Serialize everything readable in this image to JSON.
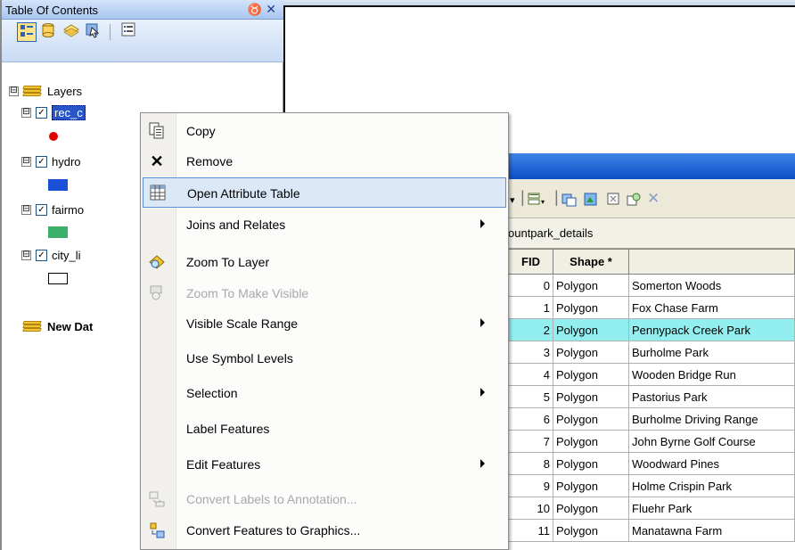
{
  "toc": {
    "title": "Table Of Contents",
    "pin_glyph": "♉",
    "close_glyph": "✕",
    "toolbar": [
      "list-by-drawing-order-icon",
      "list-by-source-icon",
      "list-by-visibility-icon",
      "list-by-selection-icon",
      "options-icon"
    ],
    "root": {
      "label": "Layers",
      "expander": "⊟"
    },
    "layers": [
      {
        "name": "rec_c",
        "checked": "✓",
        "symbol_color": "#e00000"
      },
      {
        "name": "hydro",
        "checked": "✓",
        "symbol_color": "#1a4fd8"
      },
      {
        "name": "fairmo",
        "checked": "✓",
        "symbol_color": "#3ab06a"
      },
      {
        "name": "city_li",
        "checked": "✓",
        "symbol_color": "#ffffff"
      }
    ],
    "second_frame": {
      "label": "New Dat"
    }
  },
  "context_menu": {
    "items": [
      {
        "label": "Copy",
        "icon": "copy-icon",
        "enabled": true,
        "submenu": false
      },
      {
        "label": "Remove",
        "icon": "remove-icon",
        "enabled": true,
        "submenu": false
      },
      {
        "label": "Open Attribute Table",
        "icon": "table-icon",
        "enabled": true,
        "submenu": false,
        "highlighted": true
      },
      {
        "label": "Joins and Relates",
        "icon": "",
        "enabled": true,
        "submenu": true
      },
      {
        "label": "Zoom To Layer",
        "icon": "zoom-to-layer-icon",
        "enabled": true,
        "submenu": false
      },
      {
        "label": "Zoom To Make Visible",
        "icon": "zoom-visible-icon",
        "enabled": false,
        "submenu": false
      },
      {
        "label": "Visible Scale Range",
        "icon": "",
        "enabled": true,
        "submenu": true
      },
      {
        "label": "Use Symbol Levels",
        "icon": "",
        "enabled": true,
        "submenu": false
      },
      {
        "label": "Selection",
        "icon": "",
        "enabled": true,
        "submenu": true
      },
      {
        "label": "Label Features",
        "icon": "",
        "enabled": true,
        "submenu": false
      },
      {
        "label": "Edit Features",
        "icon": "",
        "enabled": true,
        "submenu": true
      },
      {
        "label": "Convert Labels to Annotation...",
        "icon": "convert-labels-icon",
        "enabled": false,
        "submenu": false
      },
      {
        "label": "Convert Features to Graphics...",
        "icon": "convert-features-icon",
        "enabled": true,
        "submenu": false
      }
    ]
  },
  "attribute_table": {
    "tab_label": "ountpark_details",
    "columns": [
      "FID",
      "Shape *",
      ""
    ],
    "rows": [
      {
        "fid": "0",
        "shape": "Polygon",
        "name": "Somerton Woods"
      },
      {
        "fid": "1",
        "shape": "Polygon",
        "name": "Fox Chase Farm"
      },
      {
        "fid": "2",
        "shape": "Polygon",
        "name": "Pennypack Creek Park",
        "selected": true
      },
      {
        "fid": "3",
        "shape": "Polygon",
        "name": "Burholme Park"
      },
      {
        "fid": "4",
        "shape": "Polygon",
        "name": "Wooden Bridge Run"
      },
      {
        "fid": "5",
        "shape": "Polygon",
        "name": "Pastorius Park"
      },
      {
        "fid": "6",
        "shape": "Polygon",
        "name": "Burholme Driving Range"
      },
      {
        "fid": "7",
        "shape": "Polygon",
        "name": "John Byrne Golf Course"
      },
      {
        "fid": "8",
        "shape": "Polygon",
        "name": "Woodward Pines"
      },
      {
        "fid": "9",
        "shape": "Polygon",
        "name": "Holme Crispin Park"
      },
      {
        "fid": "10",
        "shape": "Polygon",
        "name": "Fluehr Park"
      },
      {
        "fid": "11",
        "shape": "Polygon",
        "name": "Manatawna Farm"
      }
    ]
  },
  "colors": {
    "title_gradient_top": "#d3e4fb",
    "title_gradient_bottom": "#a9c6ef",
    "selected_row": "#93eef0",
    "menu_highlight": "#dbe8f8",
    "table_title_blue": "#0b4fc8"
  }
}
